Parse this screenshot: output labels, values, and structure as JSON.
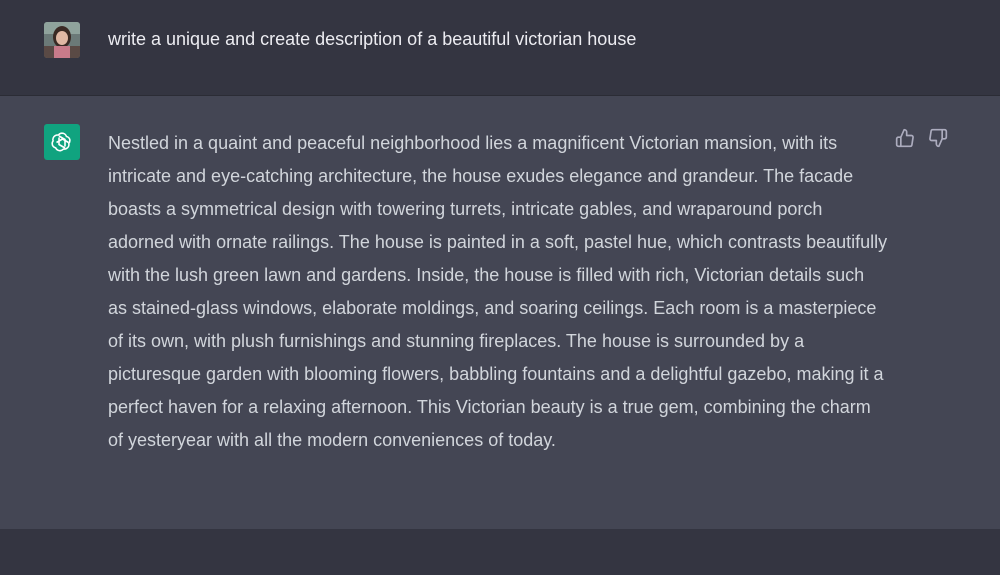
{
  "conversation": {
    "user_message": {
      "avatar_icon": "user-avatar-photo",
      "text": "write a unique and create description of a beautiful victorian house"
    },
    "assistant_message": {
      "avatar_icon": "openai-logo-icon",
      "brand_color": "#10a37f",
      "text": "Nestled in a quaint and peaceful neighborhood lies a magnificent Victorian mansion, with its intricate and eye-catching architecture, the house exudes elegance and grandeur. The facade boasts a symmetrical design with towering turrets, intricate gables, and wraparound porch adorned with ornate railings. The house is painted in a soft, pastel hue, which contrasts beautifully with the lush green lawn and gardens. Inside, the house is filled with rich, Victorian details such as stained-glass windows, elaborate moldings, and soaring ceilings. Each room is a masterpiece of its own, with plush furnishings and stunning fireplaces. The house is surrounded by a picturesque garden with blooming flowers, babbling fountains and a delightful gazebo, making it a perfect haven for a relaxing afternoon. This Victorian beauty is a true gem, combining the charm of yesteryear with all the modern conveniences of today.",
      "actions": {
        "thumbs_up_icon": "thumbs-up-icon",
        "thumbs_down_icon": "thumbs-down-icon"
      }
    }
  },
  "colors": {
    "background": "#343541",
    "assistant_background": "#444654",
    "user_text": "#ececf1",
    "assistant_text": "#d1d5db"
  }
}
